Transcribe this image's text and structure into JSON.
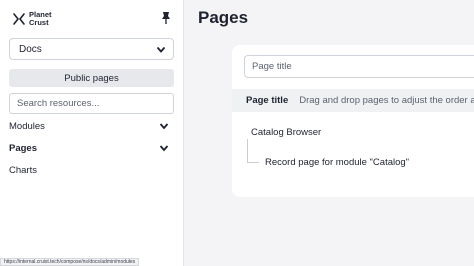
{
  "brand": {
    "line1": "Planet",
    "line2": "Crust"
  },
  "sidebar": {
    "namespace_select": {
      "value": "Docs"
    },
    "public_pages_label": "Public pages",
    "search": {
      "placeholder": "Search resources..."
    },
    "nav": [
      {
        "label": "Modules",
        "has_chevron": true,
        "active": false
      },
      {
        "label": "Pages",
        "has_chevron": true,
        "active": true
      },
      {
        "label": "Charts",
        "has_chevron": false,
        "active": false
      }
    ]
  },
  "status_bar": {
    "url": "https://internal.cruist.tech/compose/ns/docs/admin/modules"
  },
  "main": {
    "title": "Pages",
    "page_title_input": {
      "placeholder": "Page title"
    },
    "table": {
      "header_title": "Page title",
      "header_hint": "Drag and drop pages to adjust the order a",
      "rows": [
        {
          "title": "Catalog Browser"
        },
        {
          "title": "Record page for module \"Catalog\""
        }
      ]
    }
  },
  "icons": {
    "brand": "planet-crust-logo-icon",
    "pin": "pin-icon",
    "chevron": "chevron-down-icon"
  },
  "colors": {
    "background": "#f4f4f6",
    "sidebar": "#ffffff",
    "text": "#1f2330",
    "muted": "#5d6270",
    "border": "#cfd3da",
    "header_row": "#f0f1f3",
    "button_bg": "#e6e8ec"
  }
}
